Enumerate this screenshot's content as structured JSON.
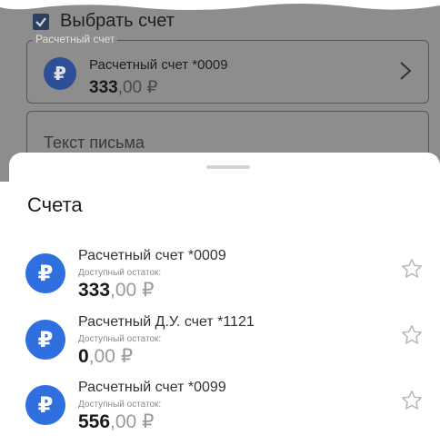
{
  "form": {
    "select_account_label": "Выбрать счет",
    "account_field_legend": "Расчетный счет",
    "selected_account": {
      "name": "Расчетный счет *0009",
      "balance_int": "333",
      "balance_dec": ",00 ₽"
    },
    "letter_placeholder": "Текст письма"
  },
  "sheet": {
    "title": "Счета",
    "accounts": [
      {
        "name": "Расчетный счет *0009",
        "sub": "Доступный остаток:",
        "balance_int": "333",
        "balance_dec": ",00 ₽"
      },
      {
        "name": "Расчетный Д.У. счет *1121",
        "sub": "Доступный остаток:",
        "balance_int": "0",
        "balance_dec": ",00 ₽"
      },
      {
        "name": "Расчетный счет *0099",
        "sub": "Доступный остаток:",
        "balance_int": "556",
        "balance_dec": ",00 ₽"
      }
    ]
  },
  "icons": {
    "currency": "ruble-icon",
    "favorite": "star-outline-icon",
    "chevron": "chevron-right-icon",
    "checkbox": "checkbox-checked-icon"
  },
  "colors": {
    "accent": "#2f6fe0",
    "overlay": "#8d8d8d"
  }
}
